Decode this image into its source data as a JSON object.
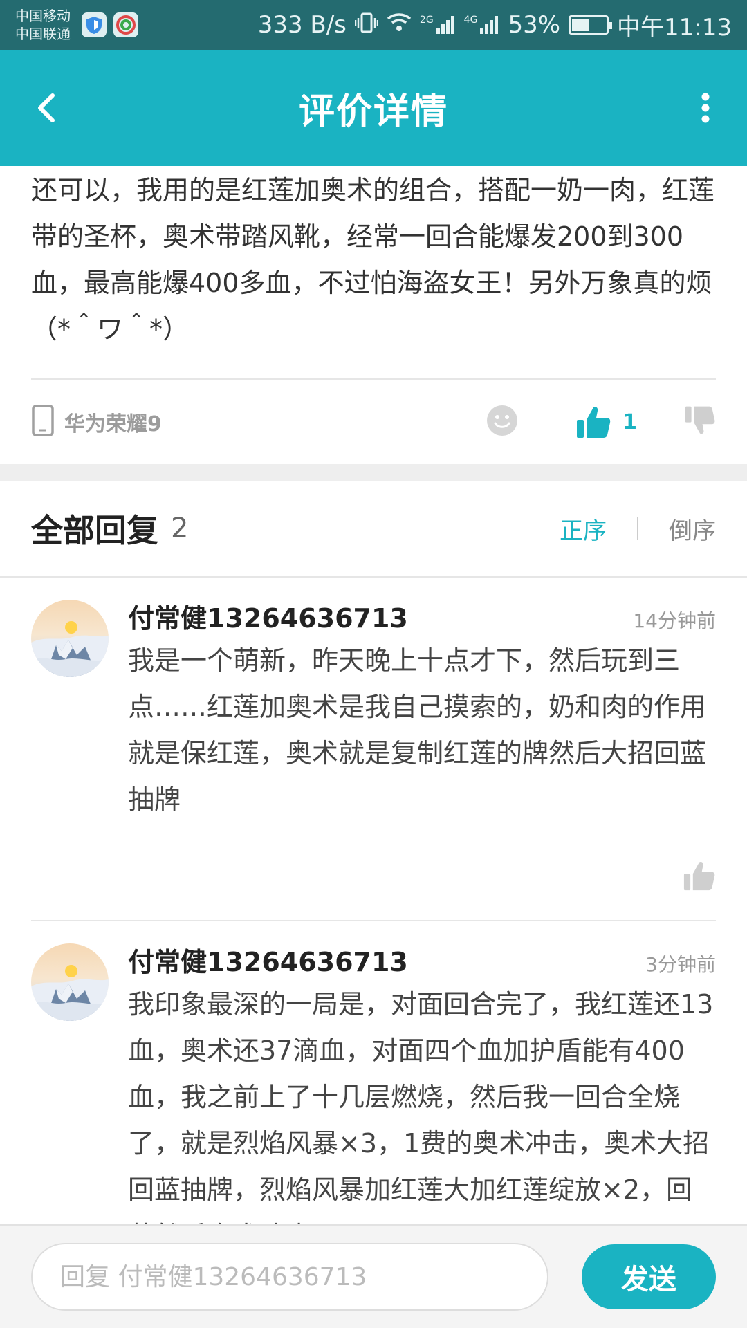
{
  "status_bar": {
    "carrier_1": "中国移动",
    "carrier_2": "中国联通",
    "net_speed": "333 B/s",
    "net_2g": "2G",
    "net_4g": "4G",
    "battery_text": "53%",
    "battery_level": 0.53,
    "time": "中午11:13",
    "icons": [
      "shield-app-icon",
      "browser-app-icon",
      "vibrate-icon",
      "wifi-icon",
      "signal-icon",
      "battery-icon"
    ]
  },
  "app_bar": {
    "title": "评价详情",
    "back_icon": "chevron-left-icon",
    "more_icon": "vertical-dots-icon"
  },
  "review": {
    "text": "还可以，我用的是红莲加奥术的组合，搭配一奶一肉，红莲带的圣杯，奥术带踏风靴，经常一回合能爆发200到300血，最高能爆400多血，不过怕海盗女王！另外万象真的烦（*＾ワ＾*）",
    "device": "华为荣耀9",
    "likes": "1"
  },
  "replies": {
    "title": "全部回复",
    "count": "2",
    "sort_asc": "正序",
    "sort_desc": "倒序",
    "items": [
      {
        "user": "付常健13264636713",
        "time": "14分钟前",
        "text": "我是一个萌新，昨天晚上十点才下，然后玩到三点……红莲加奥术是我自己摸索的，奶和肉的作用就是保红莲，奥术就是复制红莲的牌然后大招回蓝抽牌"
      },
      {
        "user": "付常健13264636713",
        "time": "3分钟前",
        "text": "我印象最深的一局是，对面回合完了，我红莲还13血，奥术还37滴血，对面四个血加护盾能有400血，我之前上了十几层燃烧，然后我一回合全烧了，就是烈焰风暴×3，1费的奥术冲击，奥术大招回蓝抽牌，烈焰风暴加红莲大加红莲绽放×2，回蓝然后奥术冲击"
      }
    ]
  },
  "composer": {
    "placeholder": "回复 付常健13264636713",
    "send_label": "发送"
  },
  "colors": {
    "accent": "#1ab3c2",
    "status_bar_bg": "#246b70",
    "text_primary": "#333333",
    "text_muted": "#999999"
  }
}
